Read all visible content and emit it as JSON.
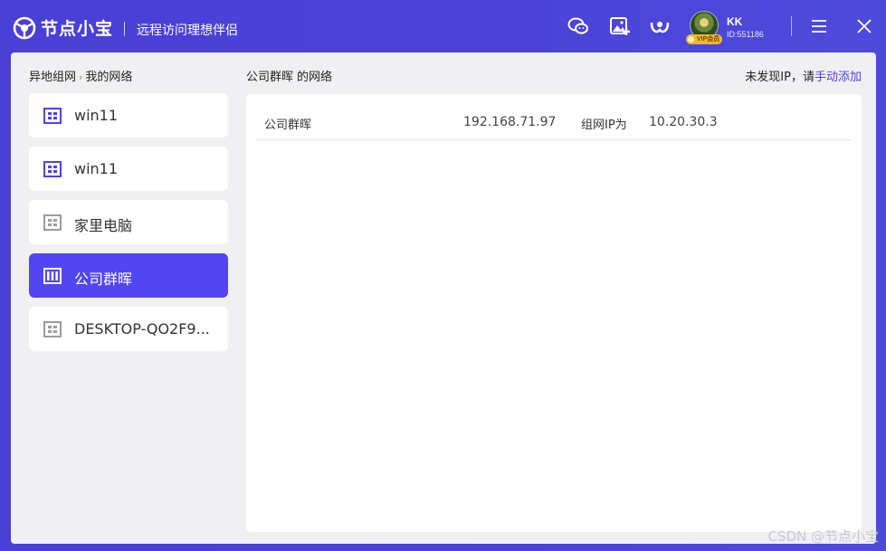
{
  "app": {
    "logo_text": "节点小宝",
    "slogan": "远程访问理想伴侣"
  },
  "user": {
    "name": "KK",
    "id": "ID:551186",
    "vip_label": "VIP会员"
  },
  "toolbar": {
    "icons": [
      "wechat-icon",
      "image-add-icon",
      "brand-icon",
      "menu-icon",
      "close-icon"
    ]
  },
  "breadcrumb": {
    "root": "异地组网",
    "separator": "›",
    "current": "我的网络"
  },
  "devices": [
    {
      "label": "win11",
      "icon": "windows-icon",
      "state": "online"
    },
    {
      "label": "win11",
      "icon": "windows-icon",
      "state": "online"
    },
    {
      "label": "家里电脑",
      "icon": "windows-icon",
      "state": "offline"
    },
    {
      "label": "公司群晖",
      "icon": "nas-icon",
      "state": "active"
    },
    {
      "label": "DESKTOP-QO2F9...",
      "icon": "windows-icon",
      "state": "offline"
    }
  ],
  "network": {
    "owner": "公司群晖",
    "suffix": "的网络",
    "notfound_text": "未发现IP，请",
    "manual_add_link": "手动添加",
    "rows": [
      {
        "name": "公司群晖",
        "ip": "192.168.71.97",
        "vip_label": "组网IP为",
        "vip": "10.20.30.3"
      }
    ]
  },
  "watermark": "CSDN @节点小宝",
  "colors": {
    "accent": "#5146f2",
    "titlebar": "#4a3fd6",
    "link": "#4e43e6",
    "online_icon": "#4e43e6",
    "offline_icon": "#9a9aa2"
  }
}
